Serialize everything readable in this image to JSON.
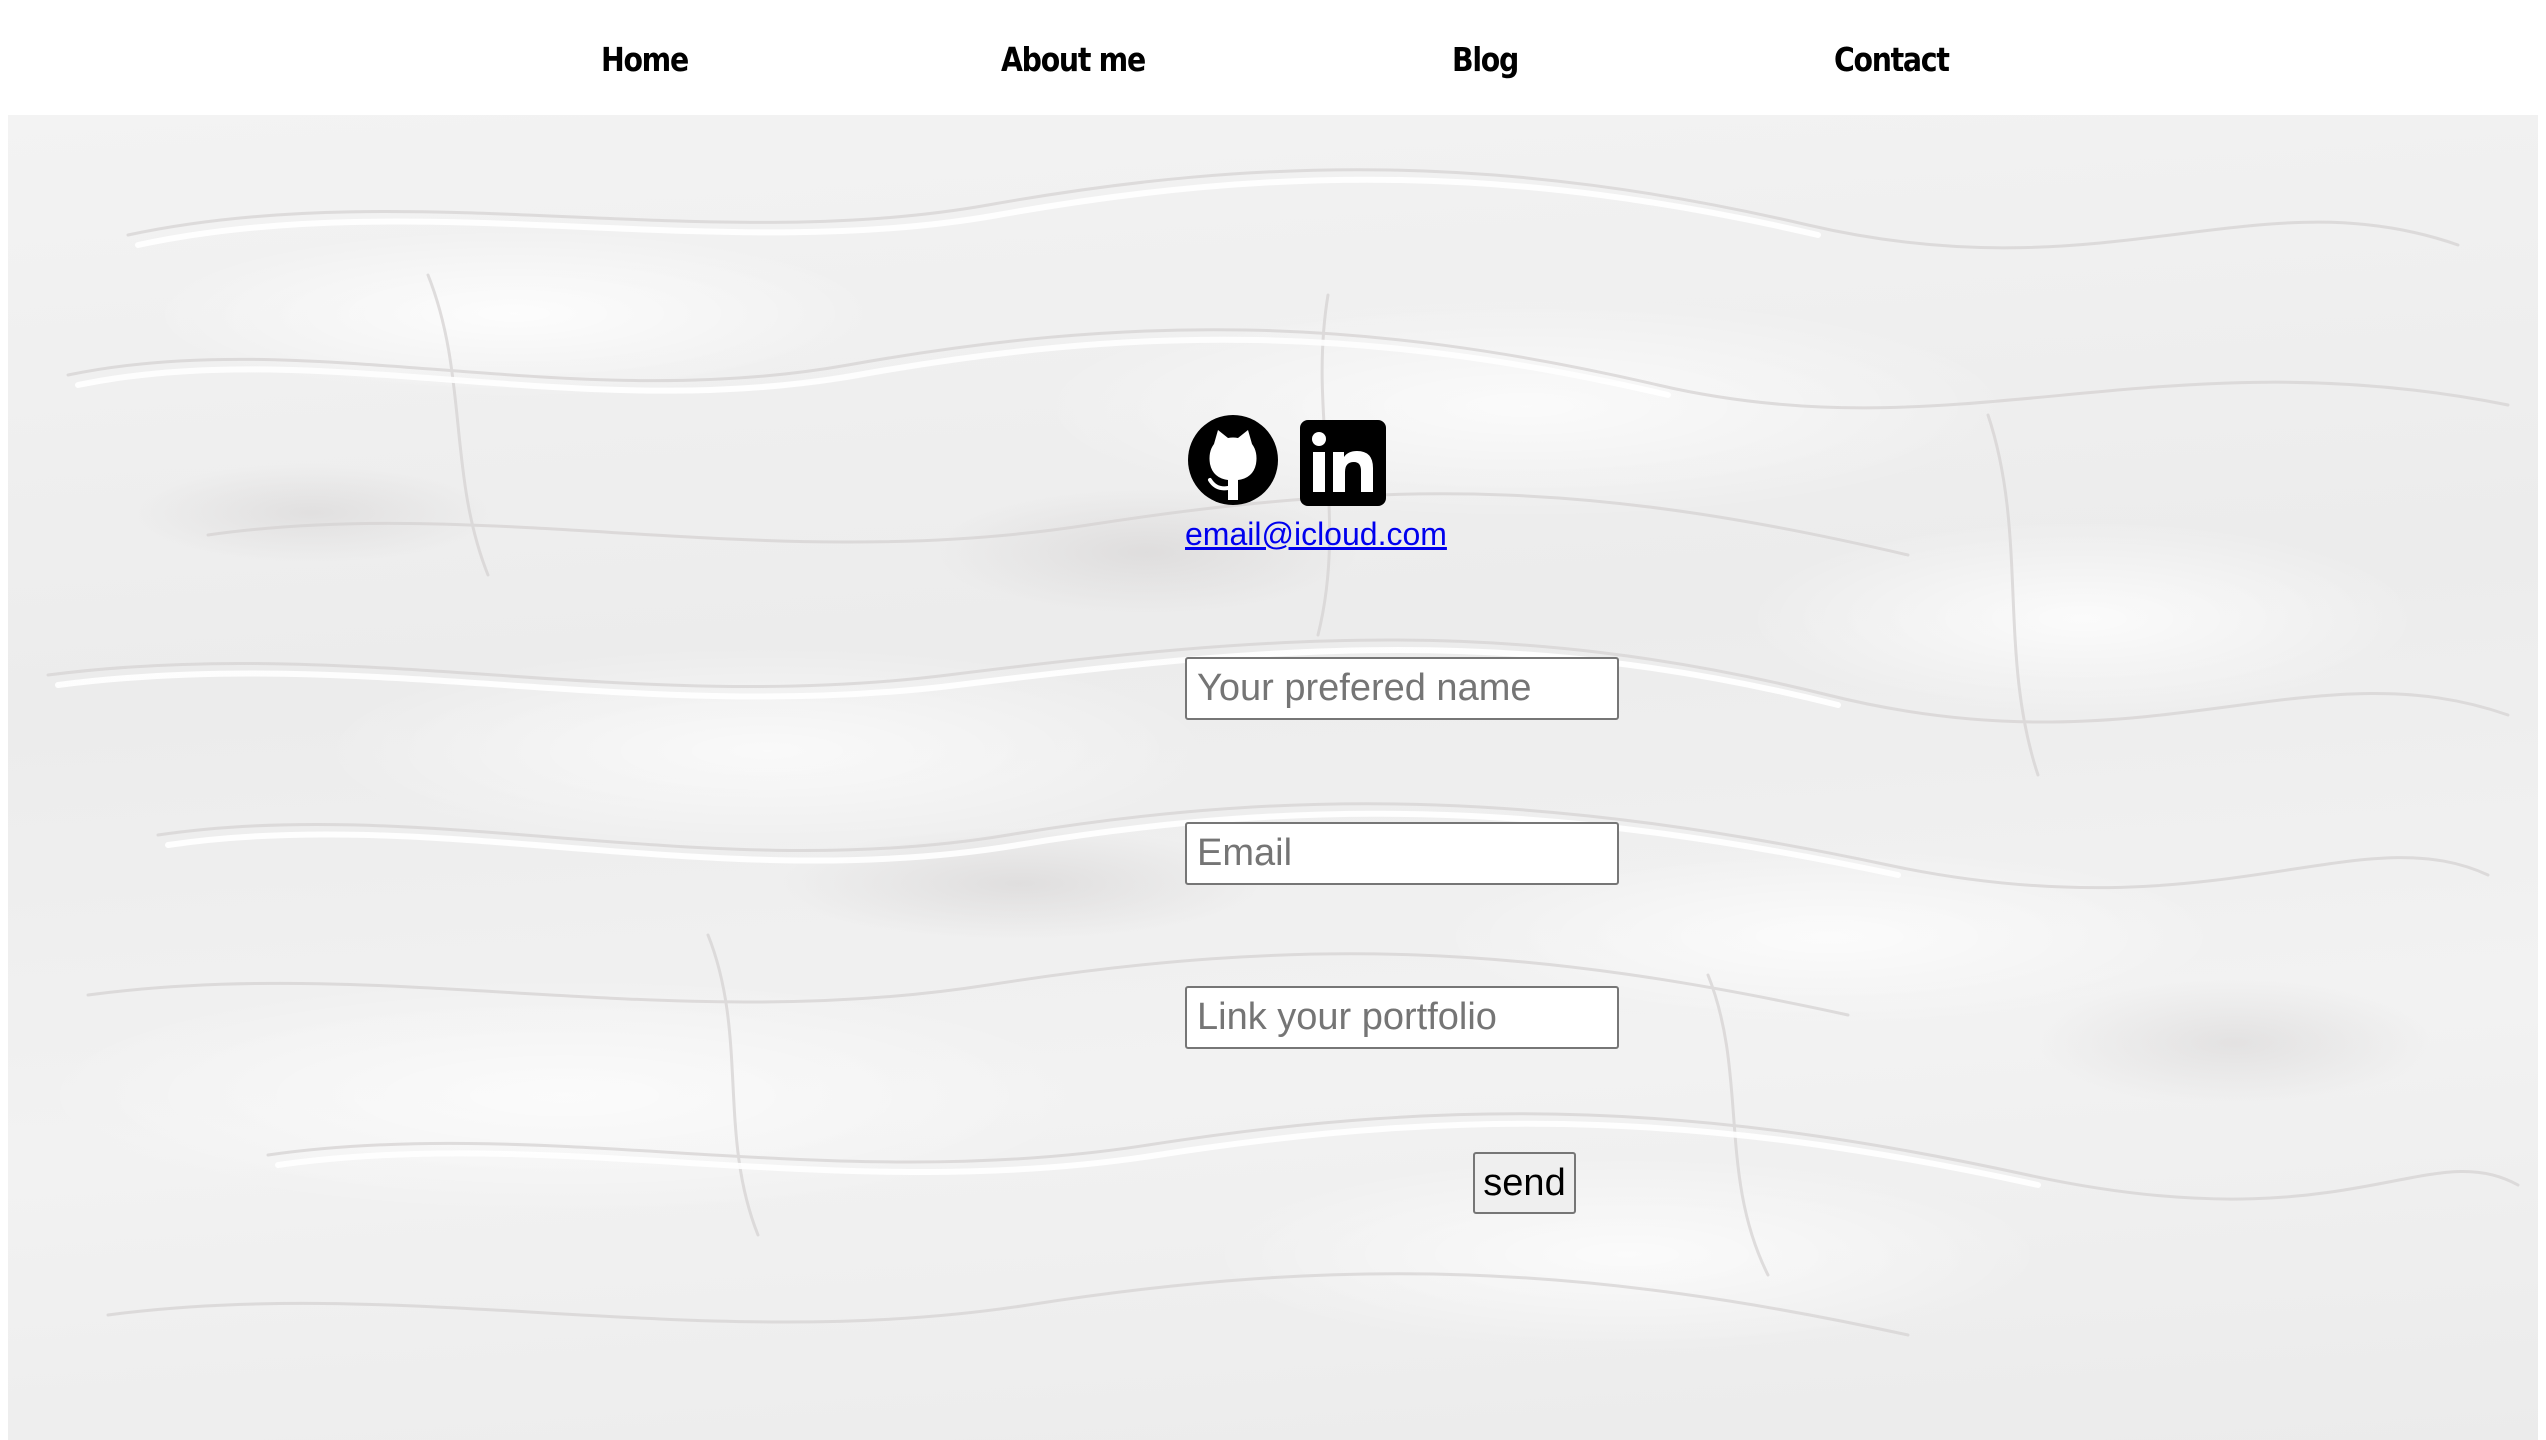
{
  "nav": {
    "items": [
      {
        "label": "Home"
      },
      {
        "label": "About me"
      },
      {
        "label": "Blog"
      },
      {
        "label": "Contact"
      }
    ]
  },
  "social": {
    "icons": [
      "github-icon",
      "linkedin-icon"
    ]
  },
  "contact": {
    "email_link": "email@icloud.com"
  },
  "form": {
    "name_placeholder": "Your prefered name",
    "email_placeholder": "Email",
    "portfolio_placeholder": "Link your portfolio",
    "send_label": "send"
  },
  "colors": {
    "link": "#0000ee",
    "background": "#efefef",
    "text": "#000000"
  }
}
